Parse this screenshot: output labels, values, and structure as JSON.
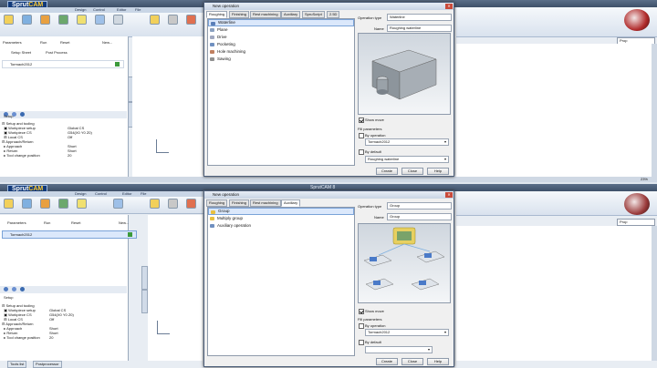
{
  "app": {
    "logo_sprut": "Sprut",
    "logo_cam": "CAM",
    "title": "SprutCAM 8",
    "menus": [
      "Design",
      "Control",
      "Editor",
      "File"
    ],
    "ribbon_labels": [
      "Parameters",
      "Run",
      "Reset",
      "New..."
    ],
    "ribbon_labels2": [
      "Setup Sheet",
      "Post Process"
    ],
    "top_right_dropdown": "Prop"
  },
  "left": {
    "root_item": "Tormach2012",
    "section": "Setup",
    "tree": [
      {
        "label": "Setup and tooling",
        "value": ""
      },
      {
        "label": "Workpiece setup",
        "value": "Global CS"
      },
      {
        "label": "Workpiece CS",
        "value": "G54(X0 Y0 Z0)"
      },
      {
        "label": "Local CS",
        "value": "Off"
      },
      {
        "label": "Approach/Return",
        "value": ""
      },
      {
        "label": "Approach",
        "value": "Short"
      },
      {
        "label": "Return",
        "value": "Short"
      },
      {
        "label": "Tool change position",
        "value": "20"
      }
    ],
    "bottom_tabs": [
      "Tools list",
      "Postprocessor"
    ]
  },
  "dialog_top": {
    "title": "New operation",
    "tabs": [
      "Roughing",
      "Finishing",
      "Rest machining",
      "Auxiliary",
      "SpruScript",
      "2.5D"
    ],
    "items": [
      "Waterline",
      "Plane",
      "Drive",
      "Pocketing",
      "Hole machining",
      "Sawing"
    ],
    "operation_type_label": "Operation type",
    "operation_type_value": "Waterline",
    "name_label": "Name",
    "name_value": "Roughing waterline",
    "show_move_label": "Show move",
    "fill_params_label": "Fill parameters",
    "by_operation_label": "By operation",
    "by_operation_value": "Tormach2012",
    "by_default_label": "By default",
    "by_default_value": "Roughing waterline",
    "buttons": [
      "Create",
      "Close",
      "Help"
    ]
  },
  "dialog_bottom": {
    "title": "New operation",
    "tabs": [
      "Roughing",
      "Finishing",
      "Rest machining",
      "Auxiliary"
    ],
    "items": [
      "Group",
      "Multiply group",
      "Auxiliary operation"
    ],
    "operation_type_label": "Operation type",
    "operation_type_value": "Group",
    "name_label": "Name",
    "name_value": "Group",
    "show_move_label": "Show move",
    "fill_params_label": "Fill parameters",
    "by_operation_label": "By operation",
    "by_operation_value": "Tormach2012",
    "by_default_label": "By default",
    "by_default_value": "",
    "buttons": [
      "Create",
      "Close",
      "Help"
    ]
  },
  "status_zoom": "23%"
}
